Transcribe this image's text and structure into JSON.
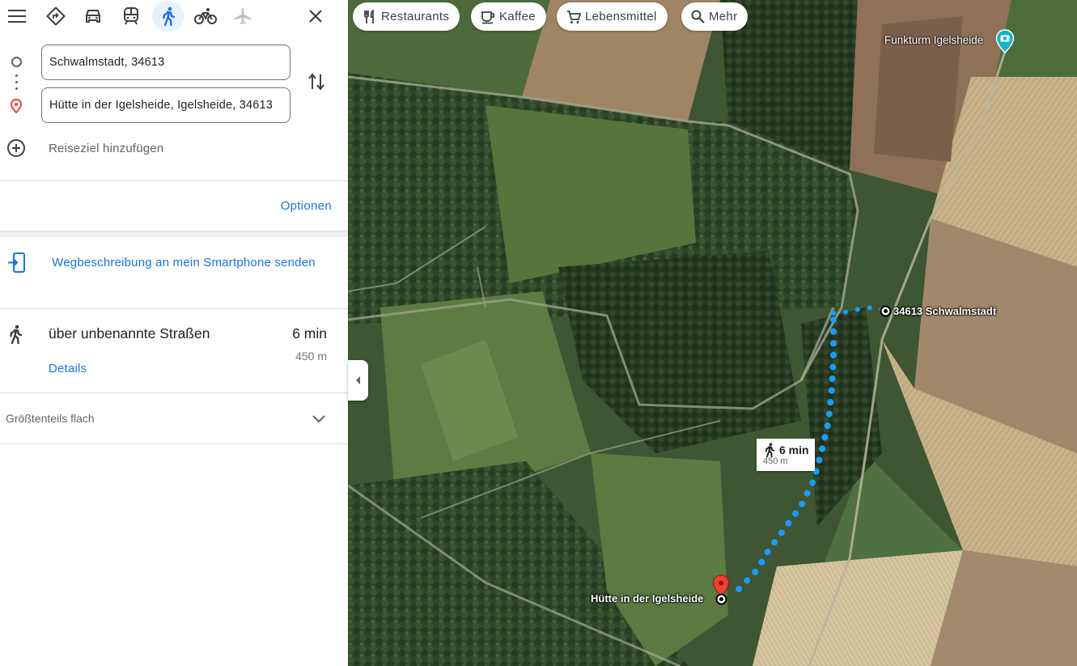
{
  "travel_modes": [
    {
      "name": "best-route",
      "icon": "directions-icon"
    },
    {
      "name": "driving",
      "icon": "car-icon"
    },
    {
      "name": "transit",
      "icon": "train-icon"
    },
    {
      "name": "walking",
      "icon": "walk-icon",
      "selected": true
    },
    {
      "name": "cycling",
      "icon": "bike-icon"
    },
    {
      "name": "flights",
      "icon": "plane-icon"
    }
  ],
  "directions": {
    "origin": "Schwalmstadt, 34613",
    "destination": "Hütte in der Igelsheide, Igelsheide, 34613",
    "add_destination": "Reiseziel hinzufügen",
    "options_label": "Optionen",
    "send_to_phone": "Wegbeschreibung an mein Smartphone senden"
  },
  "route": {
    "via": "über unbenannte Straßen",
    "duration": "6 min",
    "distance": "450 m",
    "details_label": "Details",
    "elevation": "Größtenteils flach"
  },
  "map": {
    "chips": [
      "Restaurants",
      "Kaffee",
      "Lebensmittel",
      "Mehr"
    ],
    "poi_label": "Funkturm Igelsheide",
    "start_label": "34613 Schwalmstadt",
    "end_label": "Hütte in der Igelsheide",
    "callout_time": "6 min",
    "callout_distance": "450 m",
    "colors": {
      "route": "#1a9bff",
      "accent": "#1a73e8",
      "pin": "#ea4335",
      "poi": "#12b5cb"
    }
  }
}
